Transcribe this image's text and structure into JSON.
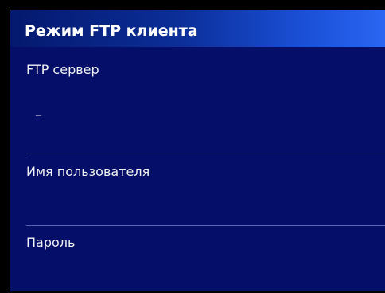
{
  "window": {
    "title": "Режим FTP клиента"
  },
  "fields": [
    {
      "label": "FTP сервер",
      "value": "–"
    },
    {
      "label": "Имя пользователя",
      "value": ""
    },
    {
      "label": "Пароль",
      "value": ""
    }
  ],
  "colors": {
    "panel_background": "#050f6a",
    "title_gradient_start": "#04196e",
    "title_gradient_end": "#2a66f2",
    "text": "#f2f2f2",
    "divider": "#5c66a8"
  }
}
